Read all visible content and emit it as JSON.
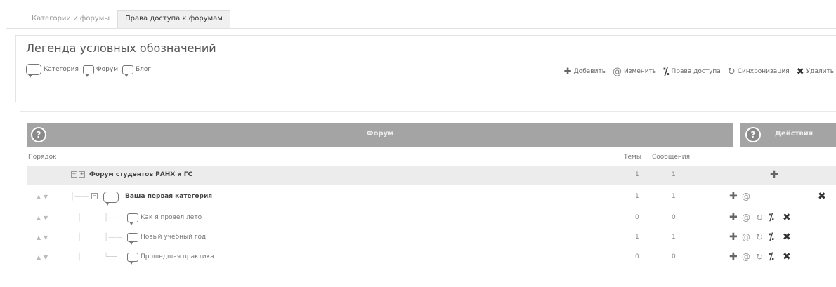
{
  "tabs": [
    {
      "label": "Категории и форумы",
      "active": false
    },
    {
      "label": "Права доступа к форумам",
      "active": true
    }
  ],
  "legend": {
    "title": "Легенда условных обозначений",
    "types": [
      "Категория",
      "Форум",
      "Блог"
    ],
    "actions": [
      "Добавить",
      "Изменить",
      "Права доступа",
      "Синхронизация",
      "Удалить"
    ]
  },
  "grid": {
    "header_title": "Форум",
    "actions_title": "Действия",
    "help_symbol": "?",
    "col_order": "Порядок",
    "col_topics": "Темы",
    "col_posts": "Сообщения",
    "rows": [
      {
        "name": "Форум студентов РАНХ и ГС",
        "topics": "1",
        "posts": "1"
      },
      {
        "name": "Ваша первая категория",
        "topics": "1",
        "posts": "1"
      },
      {
        "name": "Как я провел лето",
        "topics": "0",
        "posts": "0"
      },
      {
        "name": "Новый учебный год",
        "topics": "1",
        "posts": "1"
      },
      {
        "name": "Прошедшая практика",
        "topics": "0",
        "posts": "0"
      }
    ]
  },
  "icons": {
    "add": "✚",
    "edit": "⟳",
    "perm": "⁒",
    "sync": "↻",
    "del": "✖"
  }
}
